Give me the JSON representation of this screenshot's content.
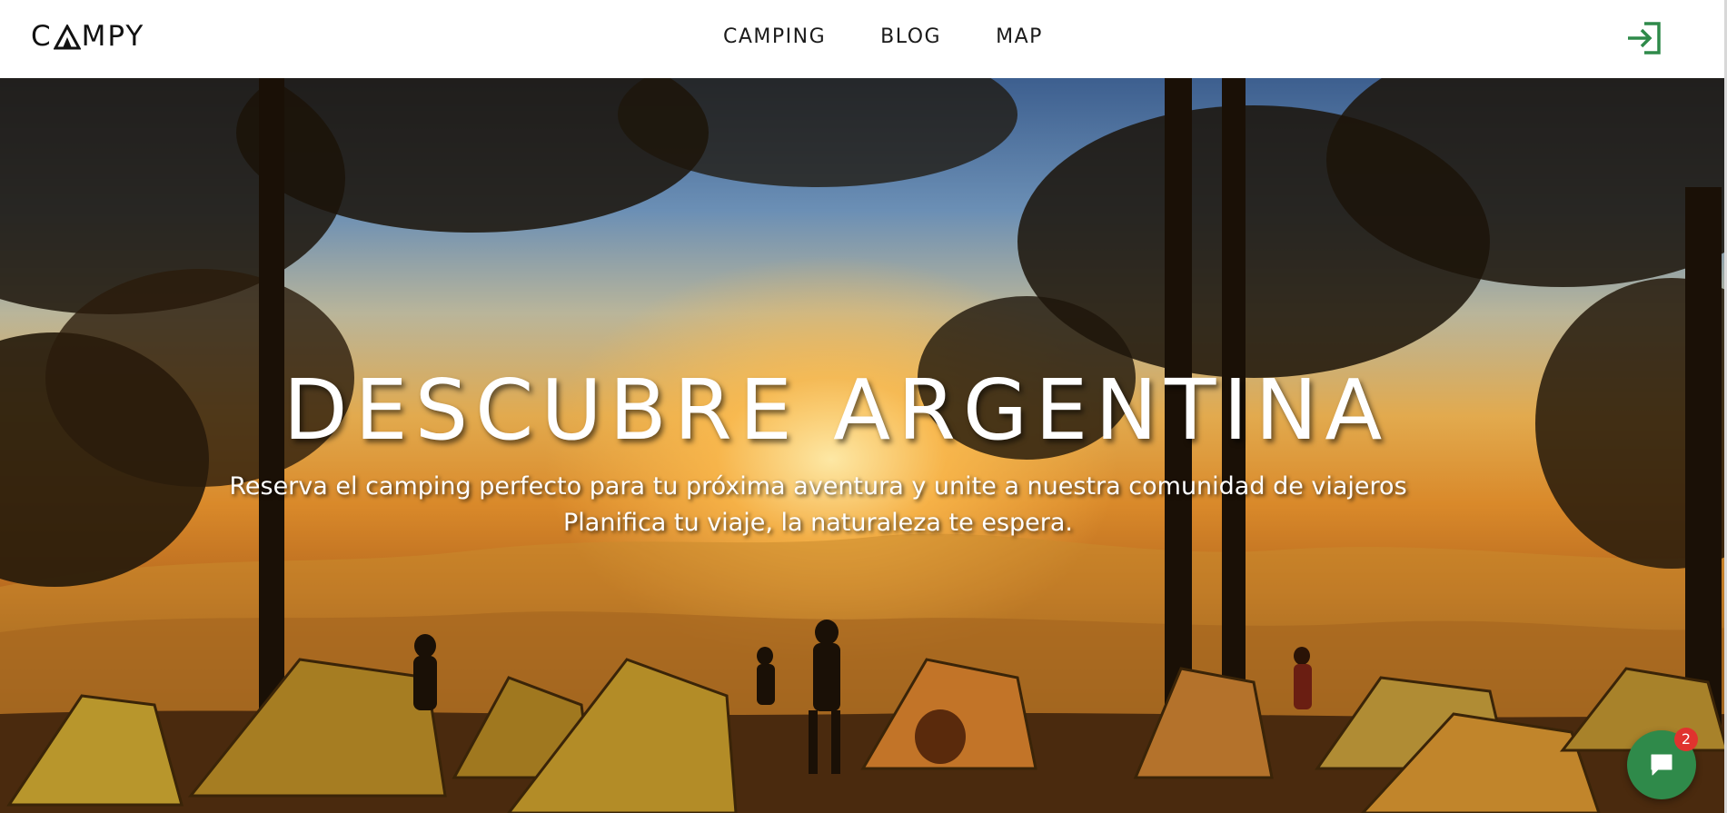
{
  "header": {
    "logo_text_before": "C",
    "logo_text_after": "MPY",
    "nav": [
      {
        "label": "CAMPING"
      },
      {
        "label": "BLOG"
      },
      {
        "label": "MAP"
      }
    ],
    "login_icon": "login-arrow-icon"
  },
  "hero": {
    "title": "DESCUBRE ARGENTINA",
    "subtitle_line1": "Reserva el camping perfecto para tu próxima aventura y unite a nuestra comunidad de viajeros",
    "subtitle_line2": "Planifica tu viaje, la naturaleza te espera."
  },
  "chat": {
    "icon": "chat-bubble-icon",
    "badge_count": "2"
  },
  "colors": {
    "accent_green": "#2f8a4a",
    "badge_red": "#e0332e",
    "header_bg": "#ffffff",
    "text_dark": "#1a1a1a"
  }
}
